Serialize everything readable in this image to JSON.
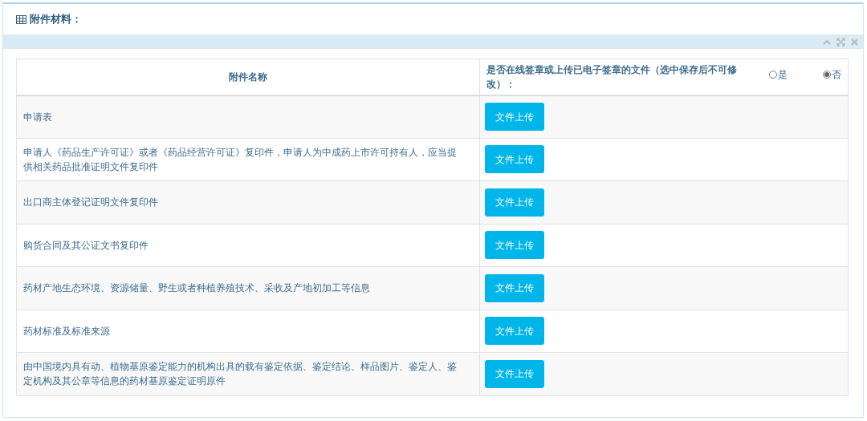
{
  "panel": {
    "title": "附件材料："
  },
  "table": {
    "columns": [
      "附件名称",
      "是否在线签章或上传已电子签章的文件（选中保存后不可修改）："
    ],
    "options": [
      {
        "label": "是",
        "selected": false
      },
      {
        "label": "否",
        "selected": true
      }
    ],
    "rows": [
      {
        "name": "申请表",
        "button": "文件上传"
      },
      {
        "name": "申请人《药品生产许可证》或者《药品经营许可证》复印件，申请人为中成药上市许可持有人，应当提供相关药品批准证明文件复印件",
        "button": "文件上传"
      },
      {
        "name": "出口商主体登记证明文件复印件",
        "button": "文件上传"
      },
      {
        "name": "购货合同及其公证文书复印件",
        "button": "文件上传"
      },
      {
        "name": "药材产地生态环境、资源储量、野生或者种植养殖技术、采收及产地初加工等信息",
        "button": "文件上传"
      },
      {
        "name": "药材标准及标准来源",
        "button": "文件上传"
      },
      {
        "name": "由中国境内具有动、植物基原鉴定能力的机构出具的载有鉴定依据、鉴定结论、样品图片、鉴定人、鉴定机构及其公章等信息的药材基原鉴定证明原件",
        "button": "文件上传"
      }
    ]
  }
}
